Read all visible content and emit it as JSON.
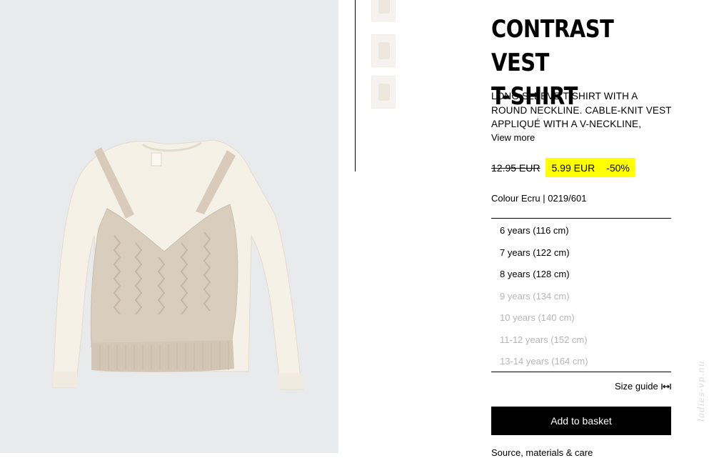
{
  "product": {
    "title_line1": "CONTRAST VEST",
    "title_line2": "T-SHIRT",
    "description": "LONG SLEEVE T-SHIRT WITH A ROUND NECKLINE. CABLE-KNIT VEST APPLIQUÉ WITH A V-NECKLINE, STRAPS AND",
    "view_more_label": "View more",
    "old_price": "12.95 EUR",
    "new_price": "5.99 EUR",
    "discount": "-50%",
    "colour_info": "Colour Ecru | 0219/601",
    "image_icon": "knit-vest-tshirt-product-image"
  },
  "sizes": [
    {
      "label": "6 years (116 cm)",
      "available": true
    },
    {
      "label": "7 years (122 cm)",
      "available": true
    },
    {
      "label": "8 years (128 cm)",
      "available": true
    },
    {
      "label": "9 years (134 cm)",
      "available": false
    },
    {
      "label": "10 years (140 cm)",
      "available": false
    },
    {
      "label": "11-12 years (152 cm)",
      "available": false
    },
    {
      "label": "13-14 years (164 cm)",
      "available": false
    }
  ],
  "size_guide": {
    "label": "Size guide",
    "icon": "resize-arrows-icon"
  },
  "add_to_basket_label": "Add to basket",
  "source_link_label": "Source, materials & care",
  "watermark_text": "ladies-vp.nu",
  "colors": {
    "image_background": "#e9eaec",
    "price_highlight": "#ffff00",
    "button_background": "#000000",
    "unavailable_text": "#b5b5b5"
  }
}
